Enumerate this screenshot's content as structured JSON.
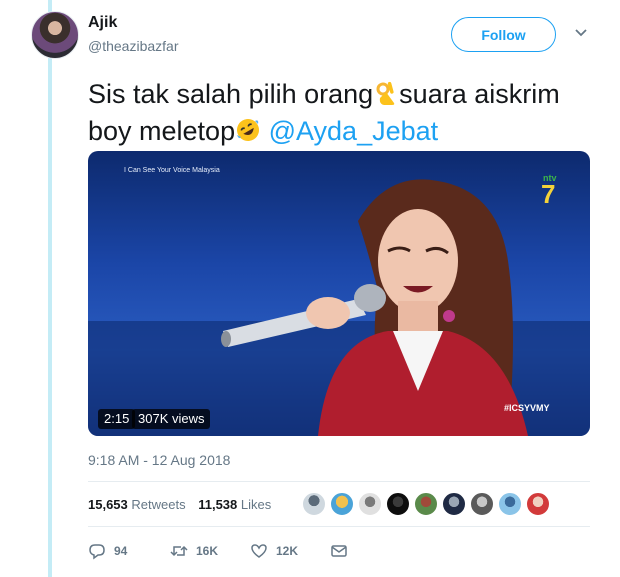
{
  "user": {
    "name": "Ajik",
    "handle": "@theazibazfar"
  },
  "follow_button": {
    "label": "Follow"
  },
  "tweet": {
    "text_part1": "Sis tak salah pilih orang",
    "text_part2": "suara aiskrim",
    "text_part3": "boy meletop",
    "mention": "@Ayda_Jebat"
  },
  "video": {
    "caption": "I Can See Your Voice Malaysia",
    "hashtag": "#ICSYVMY",
    "duration": "2:15",
    "views": "307K views"
  },
  "timestamp": "9:18 AM - 12 Aug 2018",
  "stats": {
    "retweets_count": "15,653",
    "retweets_label": "Retweets",
    "likes_count": "11,538",
    "likes_label": "Likes"
  },
  "actions": {
    "replies": "94",
    "retweets": "16K",
    "likes": "12K"
  },
  "icons": [
    "ok-hand-emoji-icon",
    "rofl-emoji-icon",
    "chevron-down-icon",
    "reply-icon",
    "retweet-icon",
    "heart-icon",
    "message-icon"
  ],
  "colors": {
    "accent": "#1da1f2",
    "muted": "#657786",
    "thread": "#c4ecf6"
  }
}
